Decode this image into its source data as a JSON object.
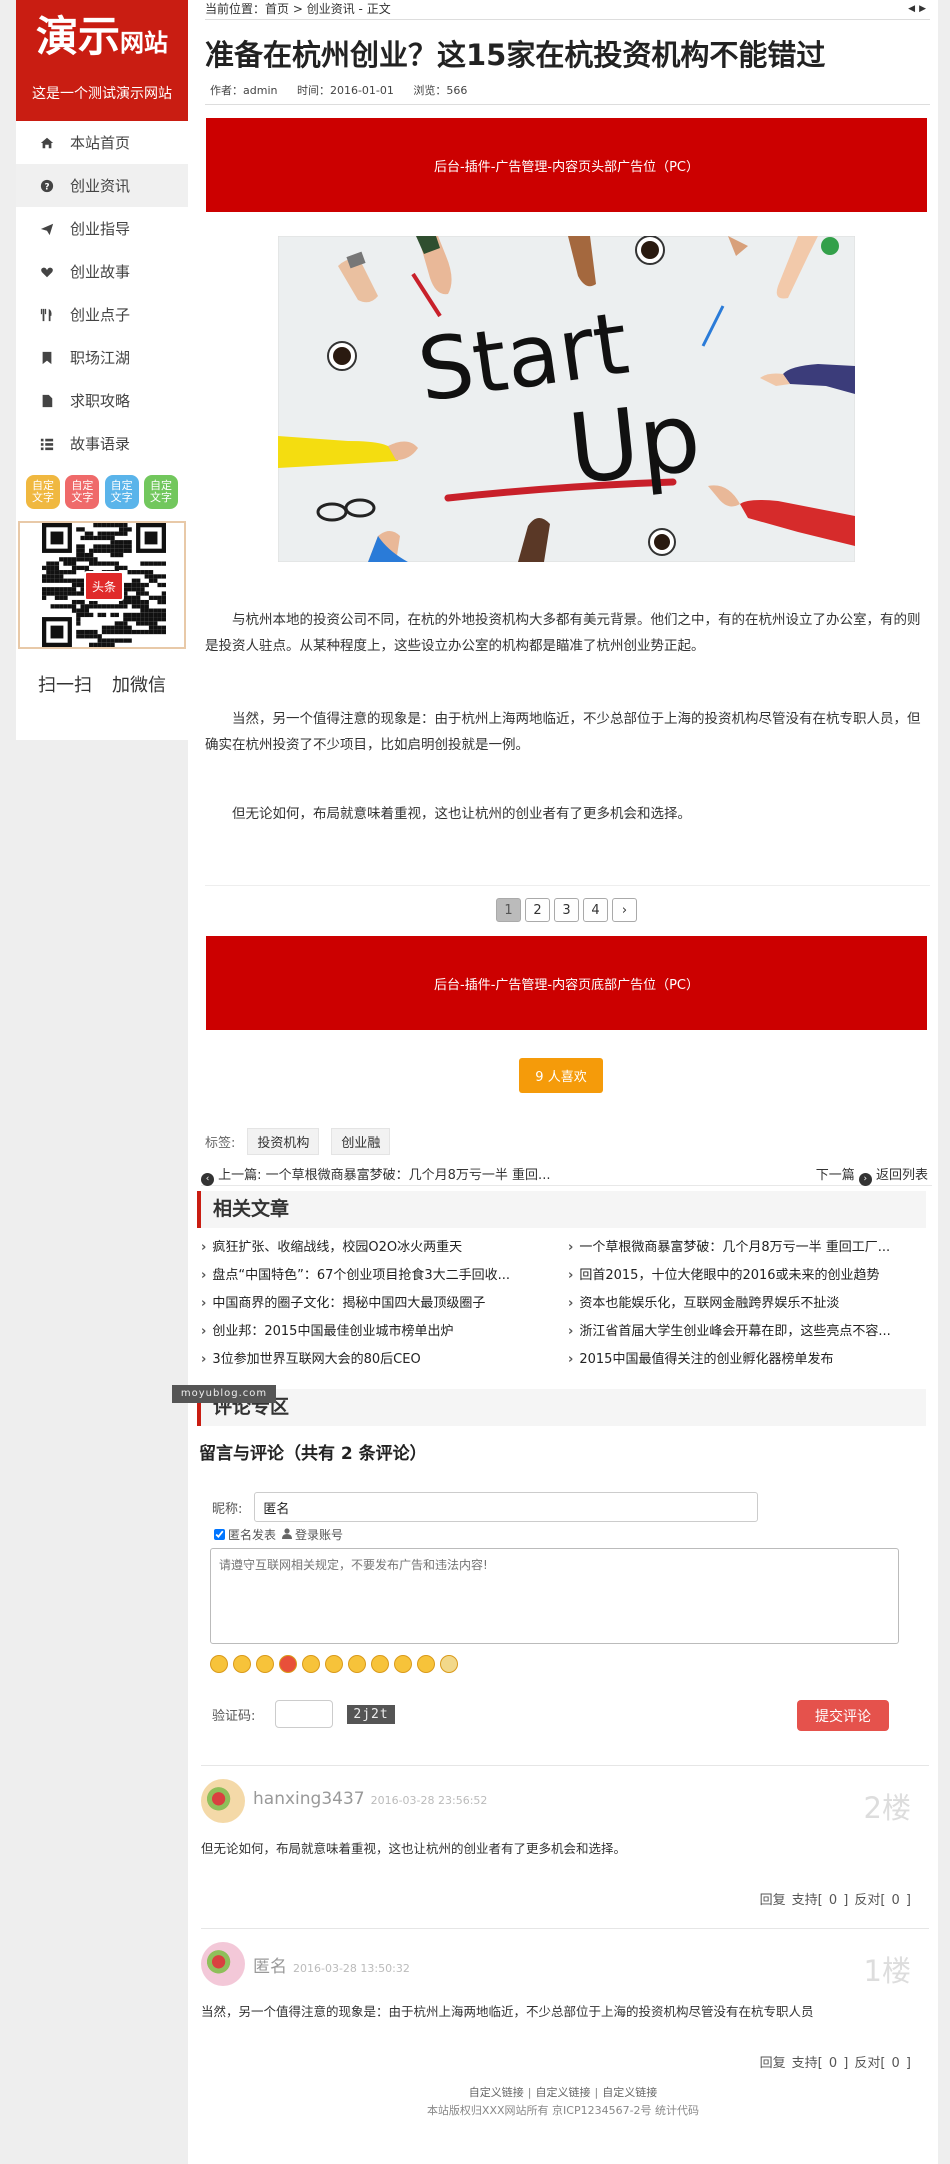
{
  "site": {
    "logo_big": "演示",
    "logo_small": "网站",
    "slogan": "这是一个测试演示网站"
  },
  "nav": [
    {
      "label": "本站首页",
      "icon": "home-icon"
    },
    {
      "label": "创业资讯",
      "icon": "question-circle-icon"
    },
    {
      "label": "创业指导",
      "icon": "send-icon"
    },
    {
      "label": "创业故事",
      "icon": "heart-icon"
    },
    {
      "label": "创业点子",
      "icon": "cutlery-icon"
    },
    {
      "label": "职场江湖",
      "icon": "bookmark-icon"
    },
    {
      "label": "求职攻略",
      "icon": "file-icon"
    },
    {
      "label": "故事语录",
      "icon": "list-icon"
    }
  ],
  "nav_active": 1,
  "custom_buttons": [
    {
      "label": "自定文字",
      "color": "#f0b840"
    },
    {
      "label": "自定文字",
      "color": "#ef6a6a"
    },
    {
      "label": "自定文字",
      "color": "#5ab4ea"
    },
    {
      "label": "自定文字",
      "color": "#72c75d"
    }
  ],
  "qr": {
    "badge": "头条",
    "caption_left": "扫一扫",
    "caption_right": "加微信"
  },
  "breadcrumb": {
    "label": "当前位置：",
    "home": "首页",
    "sep1": " > ",
    "section": "创业资讯",
    "sep2": " - ",
    "current": "正文"
  },
  "article": {
    "title": "准备在杭州创业？这15家在杭投资机构不能错过",
    "author": "作者：admin",
    "time": "时间：2016-01-01",
    "views": "浏览：566",
    "paragraphs": [
      "与杭州本地的投资公司不同，在杭的外地投资机构大多都有美元背景。他们之中，有的在杭州设立了办公室，有的则是投资人驻点。从某种程度上，这些设立办公室的机构都是瞄准了杭州创业势正起。",
      "当然，另一个值得注意的现象是：由于杭州上海两地临近，不少总部位于上海的投资机构尽管没有在杭专职人员，但确实在杭州投资了不少项目，比如启明创投就是一例。",
      "但无论如何，布局就意味着重视，这也让杭州的创业者有了更多机会和选择。"
    ],
    "photo_text_1": "Start",
    "photo_text_2": "Up"
  },
  "ads": {
    "top": "后台-插件-广告管理-内容页头部广告位（PC）",
    "bottom": "后台-插件-广告管理-内容页底部广告位（PC）"
  },
  "pagination": {
    "pages": [
      "1",
      "2",
      "3",
      "4"
    ],
    "current": 0,
    "next": "›"
  },
  "like_label": "9 人喜欢",
  "tags": {
    "label": "标签:",
    "items": [
      "投资机构",
      "创业融"
    ]
  },
  "prevnext": {
    "prev": "上一篇: 一个草根微商暴富梦破：几个月8万亏一半 重回...",
    "next_label": "下一篇",
    "back": "返回列表"
  },
  "related": {
    "title": "相关文章",
    "items": [
      "疯狂扩张、收缩战线，校园O2O冰火两重天",
      "一个草根微商暴富梦破：几个月8万亏一半 重回工厂...",
      "盘点“中国特色”：67个创业项目抢食3大二手回收...",
      "回首2015，十位大佬眼中的2016或未来的创业趋势",
      "中国商界的圈子文化：揭秘中国四大最顶级圈子",
      "资本也能娱乐化，互联网金融跨界娱乐不扯淡",
      "创业邦：2015中国最佳创业城市榜单出炉",
      "浙江省首届大学生创业峰会开幕在即，这些亮点不容...",
      "3位参加世界互联网大会的80后CEO",
      "2015中国最值得关注的创业孵化器榜单发布"
    ]
  },
  "watermark": "moyublog.com",
  "comments": {
    "section_title": "评论专区",
    "title": "留言与评论（共有 2 条评论）",
    "nick_label": "昵称:",
    "nick_value": "匿名",
    "anon_label": "匿名发表",
    "login_label": "登录账号",
    "placeholder": "请遵守互联网相关规定，不要发布广告和违法内容!",
    "captcha_label": "验证码:",
    "captcha_code": "2j2t",
    "submit": "提交评论",
    "list": [
      {
        "name": "hanxing3437",
        "time": "2016-03-28 23:56:52",
        "floor": "2楼",
        "text": "但无论如何，布局就意味着重视，这也让杭州的创业者有了更多机会和选择。",
        "reply": "回复",
        "support": "支持[ 0 ]",
        "oppose": "反对[ 0 ]"
      },
      {
        "name": "匿名",
        "time": "2016-03-28 13:50:32",
        "floor": "1楼",
        "text": "当然，另一个值得注意的现象是：由于杭州上海两地临近，不少总部位于上海的投资机构尽管没有在杭专职人员",
        "reply": "回复",
        "support": "支持[ 0 ]",
        "oppose": "反对[ 0 ]"
      }
    ]
  },
  "footer": {
    "links": [
      "自定义链接",
      "自定义链接",
      "自定义链接"
    ],
    "copyright": "本站版权归XXX网站所有 京ICP1234567-2号 统计代码"
  }
}
